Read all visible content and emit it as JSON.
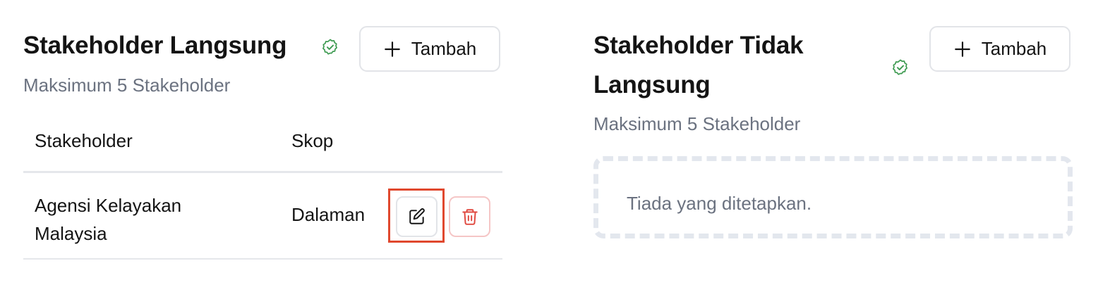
{
  "direct": {
    "title": "Stakeholder Langsung",
    "subtitle": "Maksimum 5 Stakeholder",
    "add_label": "Tambah",
    "columns": [
      "Stakeholder",
      "Skop"
    ],
    "rows": [
      {
        "stakeholder": "Agensi Kelayakan Malaysia",
        "scope": "Dalaman"
      }
    ]
  },
  "indirect": {
    "title_line1": "Stakeholder Tidak",
    "title_line2": "Langsung",
    "subtitle": "Maksimum 5 Stakeholder",
    "add_label": "Tambah",
    "empty_text": "Tiada yang ditetapkan."
  },
  "colors": {
    "success": "#3f9b52",
    "danger": "#e0483f",
    "highlight": "#e0482e"
  },
  "icons": {
    "status": "check-badge-icon",
    "add": "plus-icon",
    "edit": "edit-icon",
    "delete": "trash-icon"
  }
}
